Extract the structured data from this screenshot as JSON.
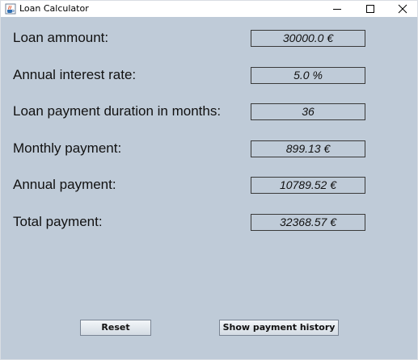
{
  "window": {
    "title": "Loan Calculator",
    "icon": "java-cup-icon"
  },
  "form": {
    "rows": [
      {
        "label": "Loan ammount:",
        "value": "30000.0 €"
      },
      {
        "label": "Annual interest rate:",
        "value": "5.0 %"
      },
      {
        "label": "Loan payment duration in months:",
        "value": "36"
      },
      {
        "label": "Monthly payment:",
        "value": "899.13 €"
      },
      {
        "label": "Annual payment:",
        "value": "10789.52 €"
      },
      {
        "label": "Total payment:",
        "value": "32368.57 €"
      }
    ]
  },
  "buttons": {
    "reset": "Reset",
    "history": "Show payment history"
  },
  "colors": {
    "background": "#bfcbd8",
    "field_border": "#3a3a3a"
  }
}
